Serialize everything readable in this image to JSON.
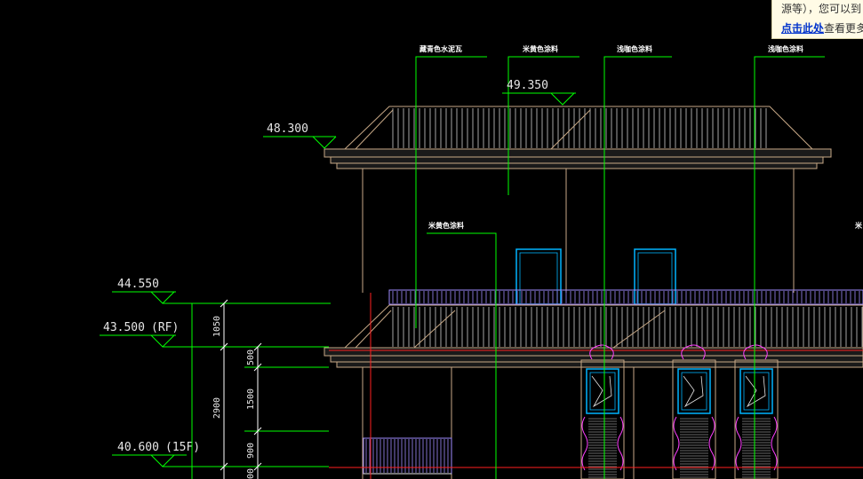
{
  "elevations": {
    "roof_peak": "49.350",
    "eave": "48.300",
    "parapet": "44.550",
    "rf_level": "43.500",
    "rf_tag": "(RF)",
    "f15_level": "40.600",
    "f15_tag": "(15F)"
  },
  "dimensions": {
    "d1050": "1050",
    "d2900": "2900",
    "d500": "500",
    "d1500": "1500",
    "d900": "900",
    "d_bottom": "00"
  },
  "material_notes": {
    "n1": "藏青色水泥瓦",
    "n2": "米黄色涂料",
    "n3": "浅咖色涂料",
    "n4": "浅咖色涂料",
    "n5": "米黄色涂料"
  },
  "tooltip": {
    "line1": "源等），您可以到",
    "link": "点击此处",
    "line2_rest": "查看更多"
  },
  "colors": {
    "background": "#000000",
    "wall": "#c8a987",
    "leader": "#00ff00",
    "window": "#00b4ff",
    "railing": "#a08cff",
    "section_line": "#ff2020",
    "dim_line": "#ffffff",
    "hatch": "#ff40ff"
  }
}
